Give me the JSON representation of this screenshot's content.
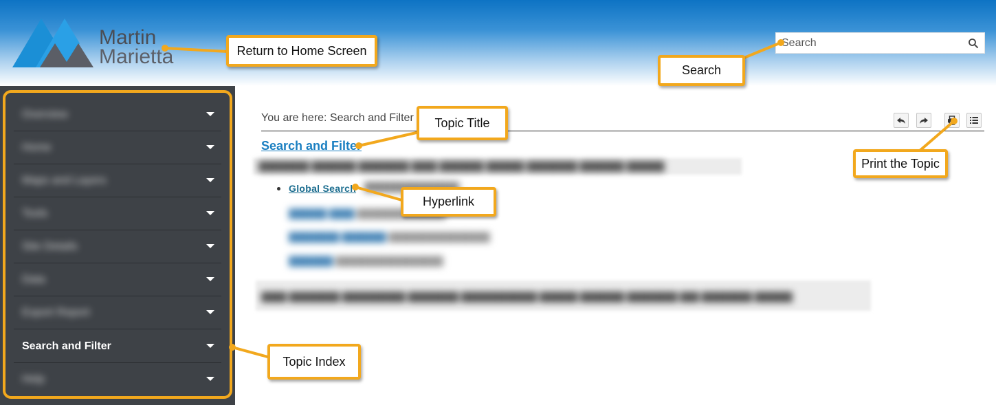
{
  "header": {
    "logo": {
      "line1": "Martin",
      "line2": "Marietta"
    },
    "search": {
      "placeholder": "Search"
    }
  },
  "sidebar": {
    "items": [
      {
        "label": "Overview",
        "blurred": true
      },
      {
        "label": "Home",
        "blurred": true
      },
      {
        "label": "Maps and Layers",
        "blurred": true
      },
      {
        "label": "Tools",
        "blurred": true
      },
      {
        "label": "Site Details",
        "blurred": true
      },
      {
        "label": "Data",
        "blurred": true
      },
      {
        "label": "Export Report",
        "blurred": true
      },
      {
        "label": "Search and Filter",
        "blurred": false
      },
      {
        "label": "Help",
        "blurred": true
      }
    ]
  },
  "breadcrumb": {
    "text": "You are here: Search and Filter"
  },
  "toolbar": {
    "icons": [
      "back-icon",
      "forward-icon",
      "print-icon",
      "toc-icon"
    ]
  },
  "content": {
    "title": "Search and Filter",
    "link": "Global Search"
  },
  "callouts": {
    "home": "Return to Home Screen",
    "search": "Search",
    "topic_title": "Topic Title",
    "print": "Print the Topic",
    "hyperlink": "Hyperlink",
    "topic_index": "Topic Index"
  },
  "colors": {
    "accent": "#f2a81d",
    "sidebar": "#3e4247",
    "link": "#1a7fc1"
  }
}
